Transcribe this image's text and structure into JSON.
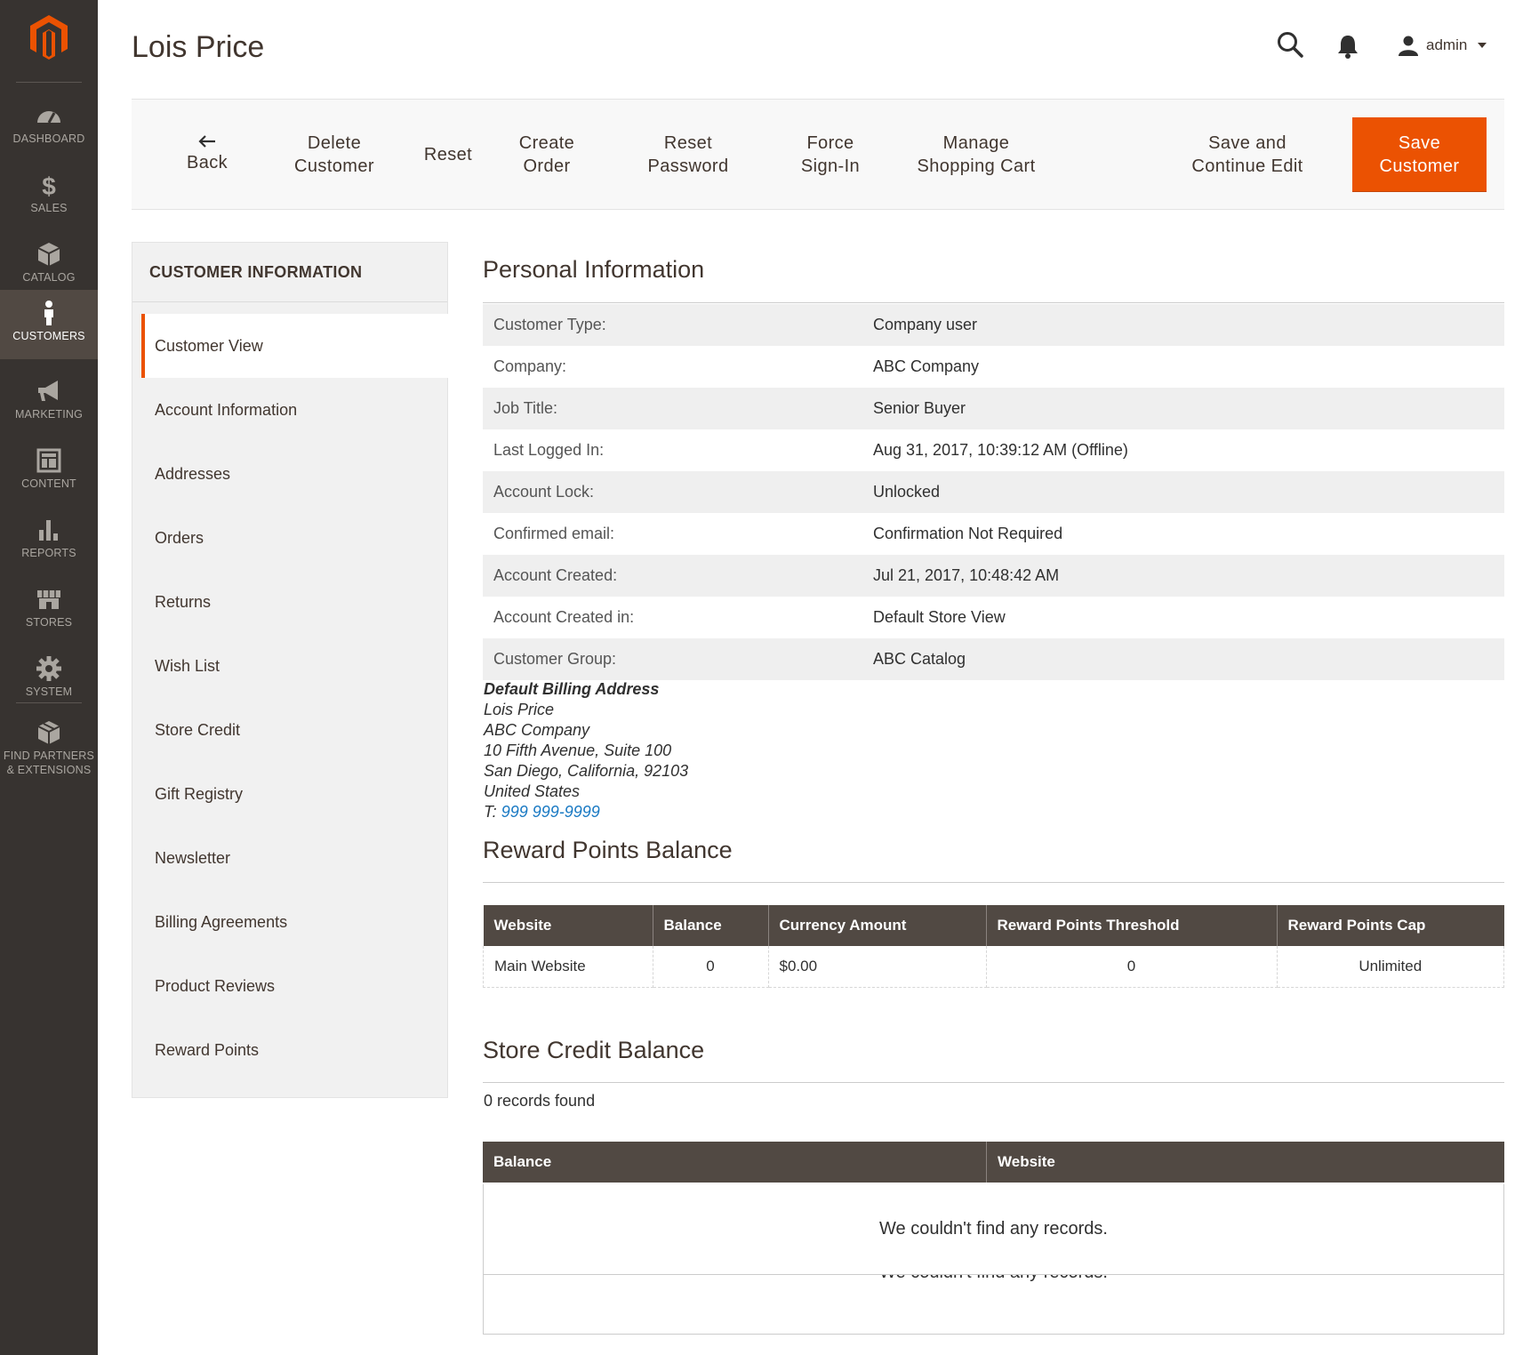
{
  "page_title": "Lois Price",
  "colors": {
    "accent": "#eb5202",
    "menu_bg": "#373330",
    "menu_active": "#514943",
    "grid_header": "#514943",
    "link": "#1979c3"
  },
  "admin_menu": {
    "logo": "magento-logo",
    "items": [
      {
        "label": "DASHBOARD",
        "icon": "dashboard-icon"
      },
      {
        "label": "SALES",
        "icon": "dollar-icon"
      },
      {
        "label": "CATALOG",
        "icon": "cube-icon"
      },
      {
        "label": "CUSTOMERS",
        "icon": "person-icon",
        "active": true
      },
      {
        "label": "MARKETING",
        "icon": "megaphone-icon"
      },
      {
        "label": "CONTENT",
        "icon": "layout-icon"
      },
      {
        "label": "REPORTS",
        "icon": "bar-chart-icon"
      },
      {
        "label": "STORES",
        "icon": "storefront-icon"
      },
      {
        "label": "SYSTEM",
        "icon": "gear-icon"
      },
      {
        "label_line1": "FIND PARTNERS",
        "label_line2": "& EXTENSIONS",
        "icon": "box-icon"
      }
    ]
  },
  "header": {
    "user": "admin",
    "search_icon": "search-icon",
    "bell_icon": "bell-icon",
    "user_icon": "user-icon"
  },
  "toolbar": {
    "back": "Back",
    "delete_l1": "Delete",
    "delete_l2": "Customer",
    "reset": "Reset",
    "create_l1": "Create",
    "create_l2": "Order",
    "resetpw_l1": "Reset",
    "resetpw_l2": "Password",
    "force_l1": "Force",
    "force_l2": "Sign-In",
    "cart_l1": "Manage",
    "cart_l2": "Shopping Cart",
    "savecont_l1": "Save and",
    "savecont_l2": "Continue Edit",
    "save_l1": "Save",
    "save_l2": "Customer"
  },
  "tabs": {
    "title": "CUSTOMER INFORMATION",
    "items": [
      "Customer View",
      "Account Information",
      "Addresses",
      "Orders",
      "Returns",
      "Wish List",
      "Store Credit",
      "Gift Registry",
      "Newsletter",
      "Billing Agreements",
      "Product Reviews",
      "Reward Points"
    ]
  },
  "personal_info": {
    "title": "Personal Information",
    "rows": [
      {
        "label": "Customer Type:",
        "value": "Company user"
      },
      {
        "label": "Company:",
        "value": "ABC Company"
      },
      {
        "label": "Job Title:",
        "value": "Senior Buyer"
      },
      {
        "label": "Last Logged In:",
        "value": "Aug 31, 2017, 10:39:12 AM (Offline)"
      },
      {
        "label": "Account Lock:",
        "value": "Unlocked"
      },
      {
        "label": "Confirmed email:",
        "value": "Confirmation Not Required"
      },
      {
        "label": "Account Created:",
        "value": "Jul 21, 2017, 10:48:42 AM"
      },
      {
        "label": "Account Created in:",
        "value": "Default Store View"
      },
      {
        "label": "Customer Group:",
        "value": "ABC Catalog"
      }
    ]
  },
  "billing_address": {
    "title": "Default Billing Address",
    "name": "Lois Price",
    "company": "ABC Company",
    "street": "10 Fifth Avenue, Suite 100",
    "city_line": "San Diego, California, 92103",
    "country": "United States",
    "phone_prefix": "T:",
    "phone": "999 999-9999"
  },
  "reward_points": {
    "title": "Reward Points Balance",
    "headers": [
      "Website",
      "Balance",
      "Currency Amount",
      "Reward Points Threshold",
      "Reward Points Cap"
    ],
    "row": [
      "Main Website",
      "0",
      "$0.00",
      "0",
      "Unlimited"
    ]
  },
  "store_credit": {
    "title": "Store Credit Balance",
    "records_found": "0 records found",
    "headers": [
      "Balance",
      "Website"
    ],
    "empty_message": "We couldn't find any records."
  }
}
